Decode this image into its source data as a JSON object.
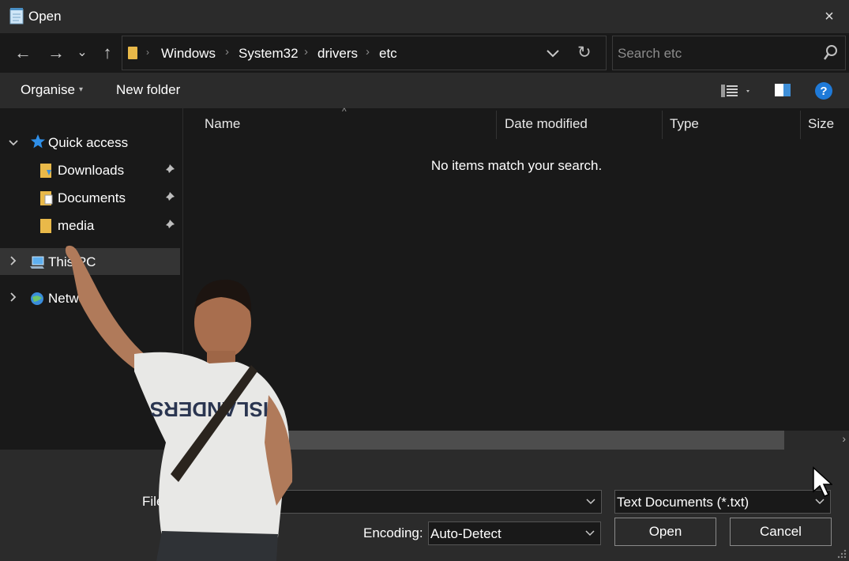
{
  "window": {
    "title": "Open",
    "close_label": "×"
  },
  "nav": {
    "back_glyph": "←",
    "forward_glyph": "→",
    "recent_glyph": "⌄",
    "up_glyph": "↑",
    "breadcrumbs": [
      "Windows",
      "System32",
      "drivers",
      "etc"
    ],
    "refresh_glyph": "↻"
  },
  "search": {
    "placeholder": "Search etc",
    "value": ""
  },
  "toolbar": {
    "organise_label": "Organise",
    "new_folder_label": "New folder"
  },
  "sidebar": {
    "quick_access": {
      "label": "Quick access"
    },
    "pinned": [
      {
        "label": "Downloads"
      },
      {
        "label": "Documents"
      },
      {
        "label": "media"
      }
    ],
    "this_pc": {
      "label": "This PC"
    },
    "network": {
      "label": "Network"
    }
  },
  "content": {
    "columns": [
      "Name",
      "Date modified",
      "Type",
      "Size"
    ],
    "empty_message": "No items match your search."
  },
  "footer": {
    "file_name_label": "File name:",
    "file_name_value": "",
    "file_type_value": "Text Documents (*.txt)",
    "encoding_label": "Encoding:",
    "encoding_value": "Auto-Detect",
    "open_label": "Open",
    "cancel_label": "Cancel"
  },
  "colors": {
    "accent_blue": "#1f7ad8",
    "folder_yellow": "#e9b949",
    "bg_dark": "#191919",
    "bg_panel": "#2b2b2b"
  }
}
